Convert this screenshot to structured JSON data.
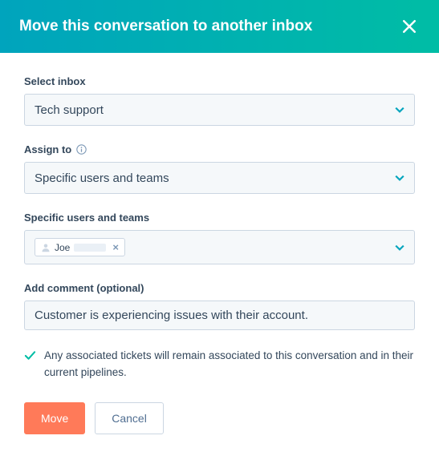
{
  "header": {
    "title": "Move this conversation to another inbox"
  },
  "fields": {
    "inbox": {
      "label": "Select inbox",
      "value": "Tech support"
    },
    "assign": {
      "label": "Assign to",
      "value": "Specific users and teams"
    },
    "users": {
      "label": "Specific users and teams",
      "chip_name": "Joe"
    },
    "comment": {
      "label": "Add comment (optional)",
      "value": "Customer is experiencing issues with their account."
    }
  },
  "notice": "Any associated tickets will remain associated to this conversation and in their current pipelines.",
  "actions": {
    "primary": "Move",
    "secondary": "Cancel"
  }
}
